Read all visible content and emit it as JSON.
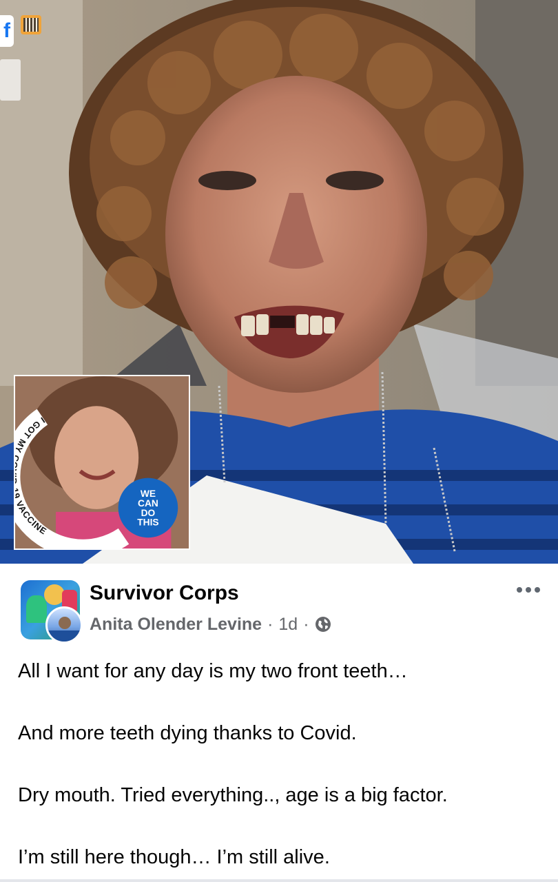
{
  "post": {
    "group_name": "Survivor Corps",
    "author": "Anita Olender Levine",
    "separator_1": "·",
    "time": "1d",
    "separator_2": "·",
    "audience_icon": "globe-icon",
    "more_icon": "more-options-icon",
    "paragraphs": [
      "All I want for any day is my two front teeth…",
      "And more teeth dying thanks to Covid.",
      "Dry mouth. Tried everything.., age is a big factor.",
      "I’m still here though… I’m still alive."
    ]
  },
  "photo": {
    "inset_frame": {
      "ring_text": "I GOT MY COVID-19 VACCINE",
      "badge_lines": [
        "WE",
        "CAN",
        "DO",
        "THIS"
      ],
      "ring_color": "#ffffff",
      "badge_color": "#1565c0"
    },
    "corner_logo": "f"
  },
  "colors": {
    "text_primary": "#050505",
    "text_secondary": "#65676b",
    "facebook_blue": "#1877f2"
  }
}
